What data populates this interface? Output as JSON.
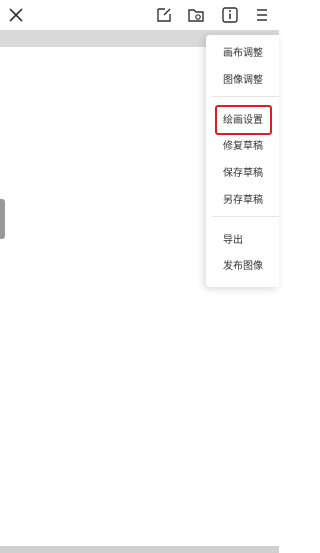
{
  "menu": {
    "items": [
      {
        "label": "画布调整"
      },
      {
        "label": "图像调整"
      },
      {
        "label": "绘画设置"
      },
      {
        "label": "修复草稿"
      },
      {
        "label": "保存草稿"
      },
      {
        "label": "另存草稿"
      },
      {
        "label": "导出"
      },
      {
        "label": "发布图像"
      }
    ]
  },
  "icons": {
    "close": "close-icon",
    "edit": "edit-icon",
    "folder": "folder-icon",
    "info": "info-icon",
    "more": "more-menu-icon"
  },
  "highlight": {
    "color": "#e01e1e",
    "target": "menu.items.2"
  }
}
